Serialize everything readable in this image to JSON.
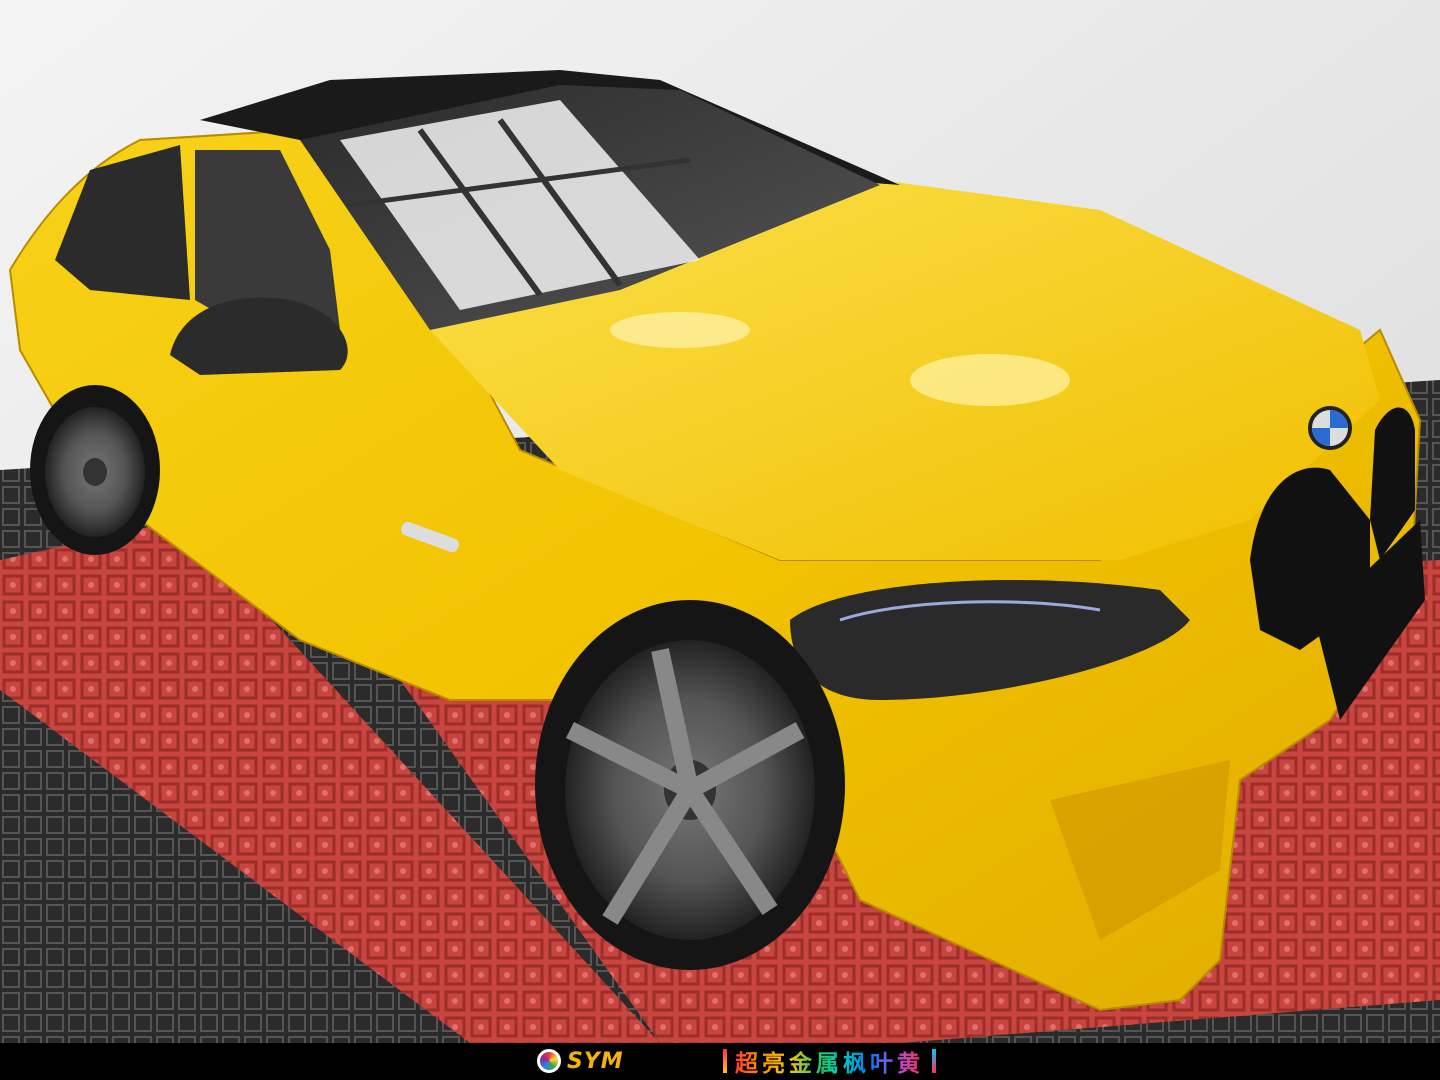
{
  "photo": {
    "subject": "yellow-wrapped-sedan",
    "colors": {
      "car_body": "#f2c300",
      "car_shadow": "#c99400",
      "roof": "#1a1a1a",
      "wall": "#e8e8e8",
      "floor_red": "#c8463f",
      "floor_dark": "#2b2b2b"
    }
  },
  "footer": {
    "brand": "SYM",
    "caption": "超亮金属枫叶黄"
  }
}
